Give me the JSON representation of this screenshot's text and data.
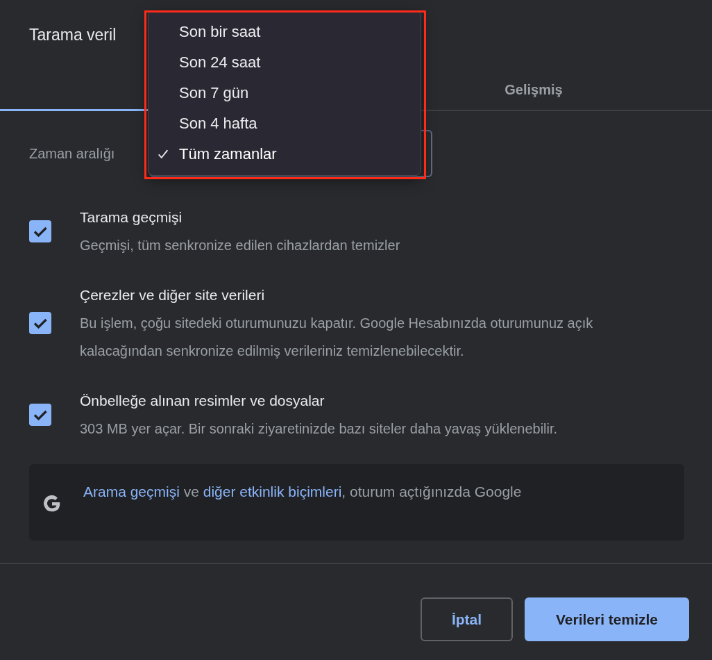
{
  "dialog": {
    "title": "Tarama veril"
  },
  "tabs": [
    {
      "selected": true
    },
    {
      "label": "Gelişmiş",
      "selected": false
    }
  ],
  "time_range": {
    "label": "Zaman aralığı"
  },
  "options": [
    {
      "title": "Tarama geçmişi",
      "description": "Geçmişi, tüm senkronize edilen cihazlardan temizler",
      "checked": true
    },
    {
      "title": "Çerezler ve diğer site verileri",
      "description": "Bu işlem, çoğu sitedeki oturumunuzu kapatır. Google Hesabınızda oturumunuz açık kalacağından senkronize edilmiş verileriniz temizlenebilecektir.",
      "checked": true
    },
    {
      "title": "Önbelleğe alınan resimler ve dosyalar",
      "description": "303 MB yer açar. Bir sonraki ziyaretinizde bazı siteler daha yavaş yüklenebilir.",
      "checked": true
    }
  ],
  "info": {
    "parts": [
      {
        "kind": "link",
        "text": "Arama geçmişi"
      },
      {
        "kind": "text",
        "text": " ve "
      },
      {
        "kind": "link",
        "text": "diğer etkinlik biçimleri"
      },
      {
        "kind": "text",
        "text": ", oturum açtığınızda Google"
      }
    ]
  },
  "buttons": [
    {
      "kind": "secondary",
      "label": "İptal"
    },
    {
      "kind": "primary",
      "label": "Verileri temizle"
    }
  ],
  "dropdown": {
    "items": [
      {
        "label": "Son bir saat",
        "selected": false
      },
      {
        "label": "Son 24 saat",
        "selected": false
      },
      {
        "label": "Son 7 gün",
        "selected": false
      },
      {
        "label": "Son 4 hafta",
        "selected": false
      },
      {
        "label": "Tüm zamanlar",
        "selected": true
      }
    ],
    "highlighted": true
  }
}
